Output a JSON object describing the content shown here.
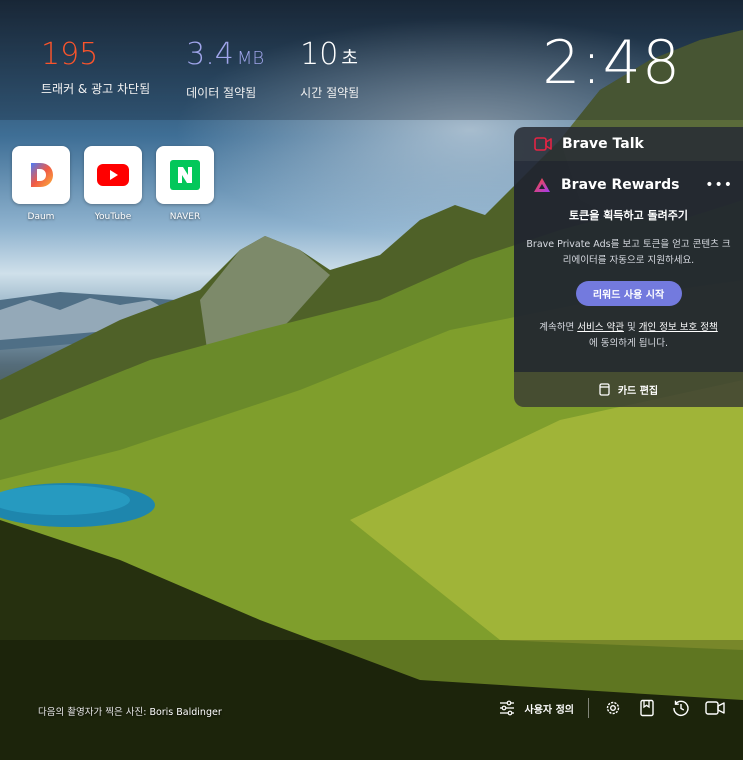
{
  "stats": [
    {
      "value": "195",
      "unit": "",
      "label": "트래커 & 광고 차단됨",
      "color": "#fb542b"
    },
    {
      "value": "3.4",
      "unit": "MB",
      "label": "데이터 절약됨",
      "color": "#a0a5eb"
    },
    {
      "value": "10",
      "unit": "초",
      "label": "시간 절약됨",
      "color": "#ffffff"
    }
  ],
  "clock": "2:48",
  "top_sites": [
    {
      "name": "Daum",
      "icon": "daum-logo"
    },
    {
      "name": "YouTube",
      "icon": "youtube-logo"
    },
    {
      "name": "NAVER",
      "icon": "naver-logo"
    }
  ],
  "brave_talk": {
    "title": "Brave Talk",
    "icon": "video-camera-icon",
    "accent": "#e32444"
  },
  "brave_rewards": {
    "title": "Brave Rewards",
    "subtitle": "토큰을 획득하고 돌려주기",
    "description": "Brave Private Ads를 보고 토큰을 얻고 콘텐츠 크리에이터를 자동으로 지원하세요.",
    "button": "리워드 사용 시작",
    "terms_prefix": "계속하면",
    "terms_link": "서비스 약관",
    "terms_and": "및",
    "privacy_link": "개인 정보 보호 정책",
    "terms_suffix": "에 동의하게 됩니다.",
    "more_label": "•••",
    "button_color": "#737ade"
  },
  "edit_cards": "카드 편집",
  "photo_credit": {
    "prefix": "다음의 촬영자가 찍은 사진:",
    "author": "Boris Baldinger"
  },
  "bottom_bar": {
    "customize": "사용자 정의",
    "icons": [
      "settings-icon",
      "bookmarks-icon",
      "history-icon",
      "brave-talk-icon"
    ]
  }
}
